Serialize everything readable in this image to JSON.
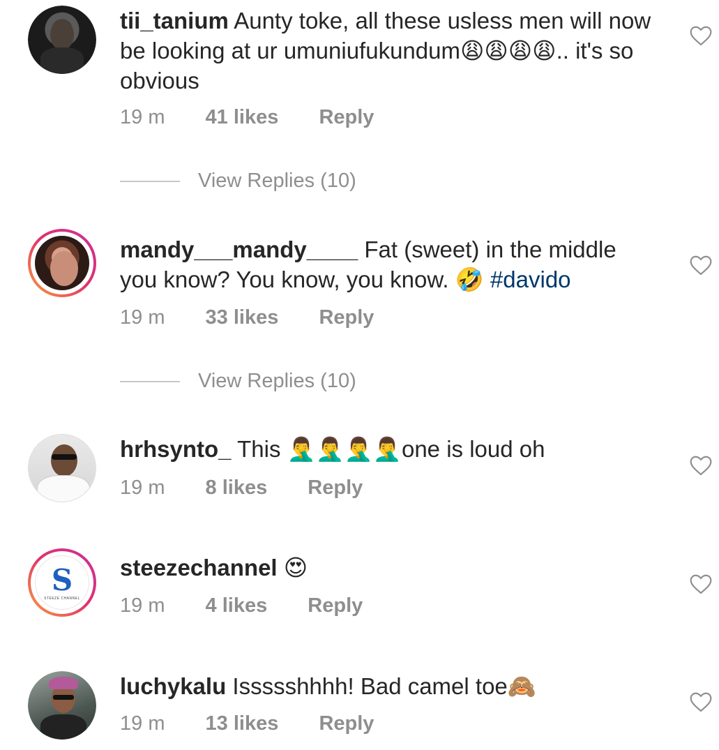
{
  "comments": [
    {
      "username": "tii_tanium",
      "text": "Aunty toke, all these usless men will now be looking at ur umuniufukundum😩😩😩😩.. it's so obvious",
      "time": "19 m",
      "likes": "41 likes",
      "reply": "Reply",
      "view_replies": "View Replies (10)"
    },
    {
      "username": "mandy___mandy____",
      "text": "Fat (sweet) in the middle you know? You know, you know. 🤣",
      "hashtag": "#davido",
      "time": "19 m",
      "likes": "33 likes",
      "reply": "Reply",
      "view_replies": "View Replies (10)"
    },
    {
      "username": "hrhsynto_",
      "text": "This 🤦‍♂️🤦‍♂️🤦‍♂️🤦‍♂️one is loud oh",
      "time": "19 m",
      "likes": "8 likes",
      "reply": "Reply"
    },
    {
      "username": "steezechannel",
      "text": "😍",
      "time": "19 m",
      "likes": "4 likes",
      "reply": "Reply",
      "avatar_letter": "S",
      "avatar_caption": "STEEZE CHANNEL"
    },
    {
      "username": "luchykalu",
      "text": "Issssshhhh! Bad camel toe🙈",
      "time": "19 m",
      "likes": "13 likes",
      "reply": "Reply"
    }
  ],
  "icons": {
    "like": "heart-outline-icon"
  },
  "colors": {
    "text": "#262626",
    "secondary": "#8e8e8e",
    "hashtag": "#00376b"
  }
}
